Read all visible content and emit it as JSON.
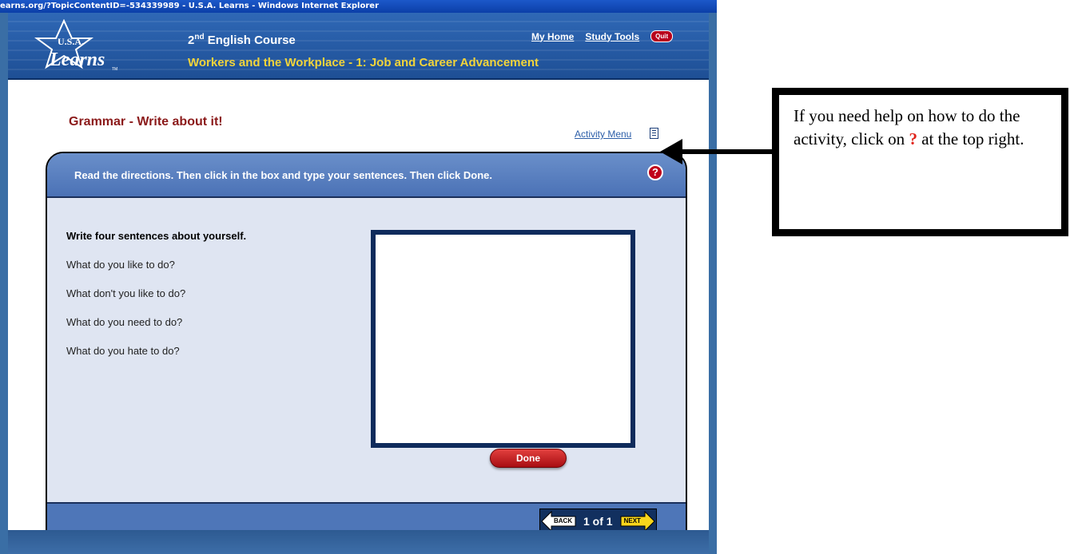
{
  "browser": {
    "title": "earns.org/?TopicContentID=-534339989 - U.S.A. Learns - Windows Internet Explorer"
  },
  "banner": {
    "logo_text_top": "U.S.A.",
    "logo_text_main": "Learns",
    "logo_tm": "TM",
    "course_ordinal": "2",
    "course_ordinal_suffix": "nd",
    "course_rest": " English Course",
    "unit_title": "Workers and the Workplace - 1: Job and Career Advancement",
    "links": {
      "my_home": "My Home",
      "study_tools": "Study Tools",
      "quit": "Quit"
    }
  },
  "content": {
    "heading": "Grammar - Write about it!",
    "activity_menu": "Activity Menu",
    "directions": "Read the directions. Then click in the box and type your sentences. Then click Done.",
    "help_symbol": "?",
    "prompt_title": "Write four sentences about yourself.",
    "questions": [
      "What do you like to do?",
      "What don't you like to do?",
      "What do you need to do?",
      "What do you hate to do?"
    ],
    "answer_value": "",
    "done_label": "Done",
    "pager": {
      "back_label": "BACK",
      "page_count": "1 of 1",
      "next_label": "NEXT"
    }
  },
  "callout": {
    "text_before": "If you need help on how to do the activity, click on ",
    "symbol": "?",
    "text_after": " at the top right."
  },
  "colors": {
    "banner_blue": "#2f68b6",
    "heading_red": "#8b1a1a",
    "unit_yellow": "#f2d43a",
    "help_red": "#c0001a",
    "textbox_border": "#0f2b5c",
    "panel_background": "#dfe5f2"
  }
}
